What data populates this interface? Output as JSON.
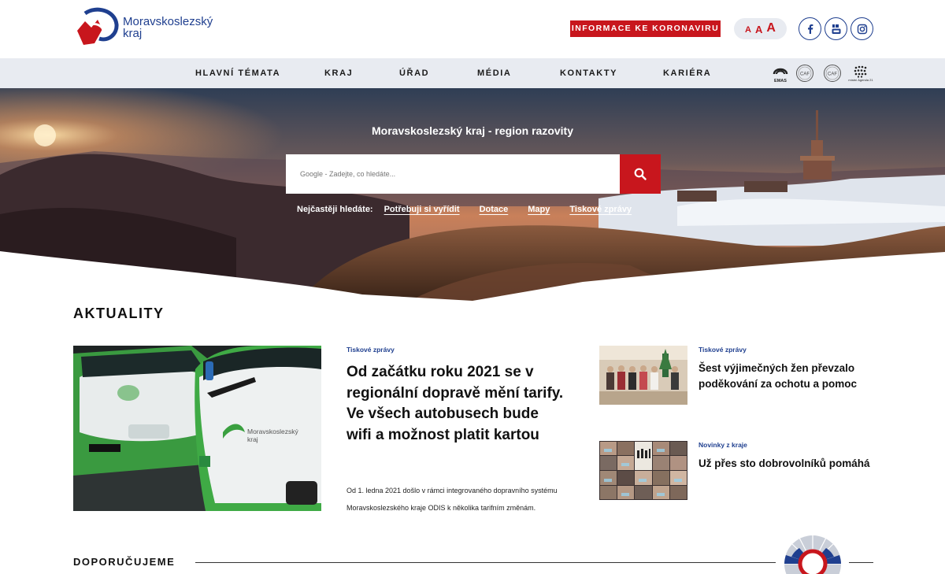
{
  "header": {
    "logo_line1": "Moravskoslezský",
    "logo_line2": "kraj",
    "corona_button": "INFORMACE KE KORONAVIRU",
    "font_sizes": [
      "A",
      "A",
      "A"
    ],
    "social": [
      "facebook-icon",
      "youtube-icon",
      "instagram-icon"
    ]
  },
  "nav": {
    "items": [
      "HLAVNÍ TÉMATA",
      "KRAJ",
      "ÚŘAD",
      "MÉDIA",
      "KONTAKTY",
      "KARIÉRA"
    ],
    "certs": [
      "EMAS",
      "CAF",
      "CAF",
      "místní Agenda 21"
    ]
  },
  "hero": {
    "title": "Moravskoslezský kraj - region razovity",
    "search_placeholder": "Google - Zadejte, co hledáte...",
    "frequent_label": "Nejčastěji hledáte:",
    "frequent_links": [
      "Potřebuji si vyřídit",
      "Dotace",
      "Mapy",
      "Tiskové zprávy"
    ]
  },
  "news": {
    "section_title": "AKTUALITY",
    "main": {
      "category": "Tiskové zprávy",
      "headline": "Od začátku roku 2021 se v regionální dopravě mění tarify. Ve všech autobusech bude wifi a možnost platit kartou",
      "perex": "Od 1. ledna 2021 došlo v rámci integrovaného dopravního systému Moravskoslezského kraje ODIS k několika tarifním změnám.",
      "bus_logo_line1": "Moravskoslezský",
      "bus_logo_line2": "kraj"
    },
    "side": [
      {
        "category": "Tiskové zprávy",
        "title": "Šest výjimečných žen převzalo poděkování za ochotu a pomoc"
      },
      {
        "category": "Novinky z kraje",
        "title": "Už přes sto dobrovolníků pomáhá"
      }
    ]
  },
  "recommend": {
    "section_title": "DOPORUČUJEME"
  },
  "colors": {
    "brand_red": "#c8161d",
    "brand_blue": "#1f3f8f",
    "nav_bg": "#e8ebf1"
  }
}
